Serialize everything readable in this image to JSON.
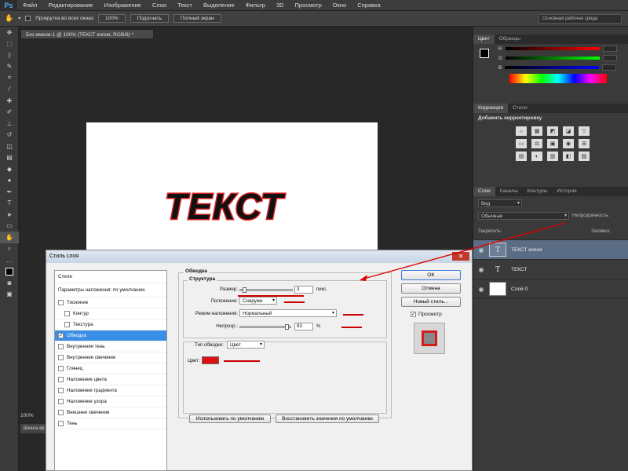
{
  "menu": {
    "logo": "Ps",
    "items": [
      "Файл",
      "Редактирование",
      "Изображение",
      "Слои",
      "Текст",
      "Выделение",
      "Фильтр",
      "3D",
      "Просмотр",
      "Окно",
      "Справка"
    ]
  },
  "options": {
    "scroll_all": "Прокрутка во всех окнах",
    "zoom": "100%",
    "fit": "Подогнать",
    "fullscreen": "Полный экран",
    "workspace": "Основная рабочая среда"
  },
  "document": {
    "tab": "Без имени-1 @ 100% (ТЕКСТ копия, RGB/8) *",
    "canvas_text": "ТЕКСТ",
    "zoom_status": "100%",
    "timeline": "Шкала вр"
  },
  "color_panel": {
    "tabs": [
      "Цвет",
      "Образцы"
    ],
    "channels": [
      "R",
      "G",
      "B"
    ]
  },
  "correction_panel": {
    "tabs": [
      "Коррекция",
      "Стили"
    ],
    "heading": "Добавить корректировку",
    "icons": [
      "☼",
      "▦",
      "◩",
      "◪",
      "▽",
      "▭",
      "⚖",
      "▣",
      "◉",
      "⊞",
      "▤",
      "◐",
      "▥",
      "◧",
      "▨"
    ]
  },
  "layers_panel": {
    "tabs": [
      "Слои",
      "Каналы",
      "Контуры",
      "История"
    ],
    "filter": "Вид",
    "blend": "Обычные",
    "opacity_label": "Непрозрачность:",
    "lock_label": "Закрепить:",
    "fill_label": "Заливка:",
    "layers": [
      {
        "name": "ТЕКСТ копия",
        "thumb": "T",
        "selected": true
      },
      {
        "name": "ТЕКСТ",
        "thumb": "T",
        "selected": false
      },
      {
        "name": "Слой 0",
        "thumb": "",
        "selected": false
      }
    ]
  },
  "dialog": {
    "title": "Стиль слоя",
    "close": "✕",
    "styles_header": "Стили",
    "blend_options": "Параметры наложения: по умолчанию",
    "style_items": [
      {
        "label": "Тиснение",
        "checked": false,
        "sub": false
      },
      {
        "label": "Контур",
        "checked": false,
        "sub": true
      },
      {
        "label": "Текстура",
        "checked": false,
        "sub": true
      },
      {
        "label": "Обводка",
        "checked": true,
        "sub": false
      },
      {
        "label": "Внутренняя тень",
        "checked": false,
        "sub": false
      },
      {
        "label": "Внутреннее свечение",
        "checked": false,
        "sub": false
      },
      {
        "label": "Глянец",
        "checked": false,
        "sub": false
      },
      {
        "label": "Наложение цвета",
        "checked": false,
        "sub": false
      },
      {
        "label": "Наложение градиента",
        "checked": false,
        "sub": false
      },
      {
        "label": "Наложение узора",
        "checked": false,
        "sub": false
      },
      {
        "label": "Внешнее свечение",
        "checked": false,
        "sub": false
      },
      {
        "label": "Тень",
        "checked": false,
        "sub": false
      }
    ],
    "stroke": {
      "group_title": "Обводка",
      "structure_title": "Структура",
      "size_label": "Размер:",
      "size_value": "3",
      "size_unit": "пикс.",
      "position_label": "Положение:",
      "position_value": "Снаружи",
      "blend_label": "Режим наложения:",
      "blend_value": "Нормальный",
      "opacity_label": "Непрозр.:",
      "opacity_value": "93",
      "opacity_unit": "%",
      "fill_type_label": "Тип обводки:",
      "fill_type_value": "Цвет",
      "color_label": "Цвет:",
      "color": "#e01010"
    },
    "buttons": {
      "ok": "OK",
      "cancel": "Отмена",
      "new_style": "Новый стиль...",
      "preview": "Просмотр",
      "set_default": "Использовать по умолчанию",
      "reset_default": "Восстановить значения по умолчанию"
    }
  }
}
